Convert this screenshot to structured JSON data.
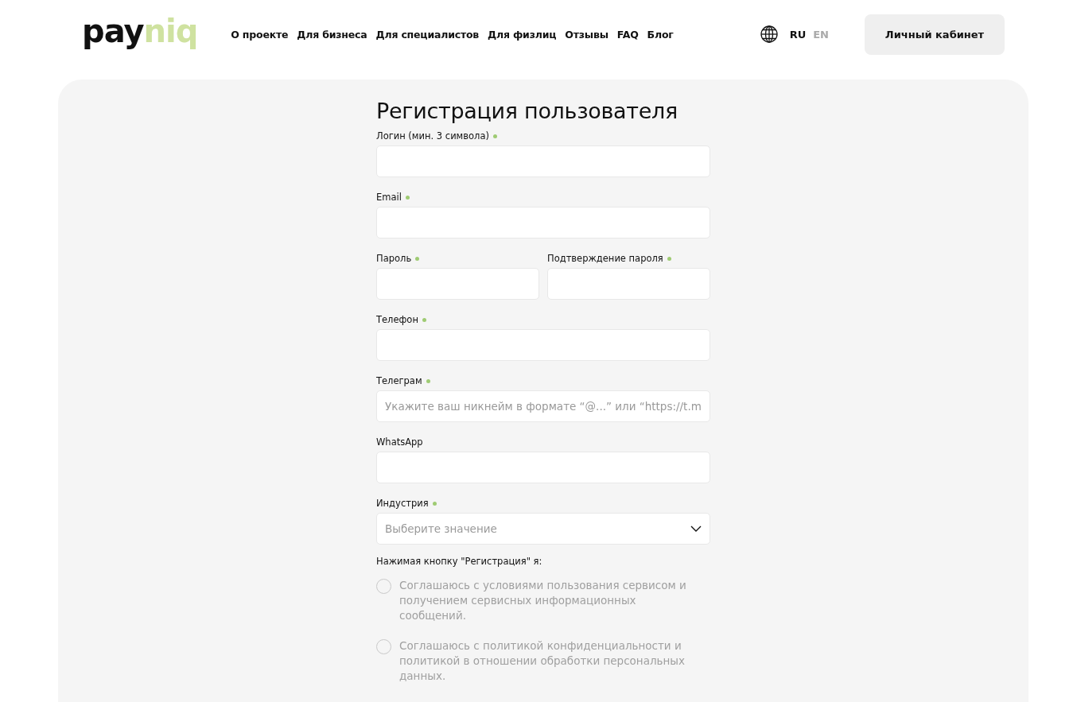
{
  "header": {
    "logo": [
      {
        "text": "pay",
        "color": "#111111"
      },
      {
        "text": "niq",
        "color": "#cfe2a0"
      }
    ],
    "nav": [
      "О проекте",
      "Для бизнеса",
      "Для специалистов",
      "Для физлиц",
      "Отзывы",
      "FAQ",
      "Блог"
    ],
    "languages": [
      {
        "label": "RU",
        "selected": true
      },
      {
        "label": "EN",
        "selected": false
      }
    ],
    "account_button": "Личный кабинет"
  },
  "form": {
    "title": "Регистрация пользователя",
    "rows": [
      [
        {
          "kind": "text",
          "label": "Логин (мин. 3 символа)",
          "required": true
        }
      ],
      [
        {
          "kind": "text",
          "label": "Email",
          "required": true
        }
      ],
      [
        {
          "kind": "text",
          "label": "Пароль",
          "required": true
        },
        {
          "kind": "text",
          "label": "Подтверждение пароля",
          "required": true
        }
      ],
      [
        {
          "kind": "text",
          "label": "Телефон",
          "required": true
        }
      ],
      [
        {
          "kind": "text",
          "label": "Телеграм",
          "required": true,
          "placeholder": "Укажите ваш никнейм в формате “@...” или “https://t.m"
        }
      ],
      [
        {
          "kind": "text",
          "label": "WhatsApp",
          "required": false
        }
      ],
      [
        {
          "kind": "select",
          "label": "Индустрия",
          "required": true,
          "placeholder": "Выберите значение"
        }
      ]
    ],
    "consent_intro": "Нажимая кнопку \"Регистрация\" я:",
    "consents": [
      {
        "label": "Соглашаюсь с условиями пользования сервисом и получением сервисных информационных сообщений.",
        "checked": false
      },
      {
        "label": "Соглашаюсь с политикой конфиденциальности и политикой в отношении обработки персональных данных.",
        "checked": false
      }
    ]
  }
}
